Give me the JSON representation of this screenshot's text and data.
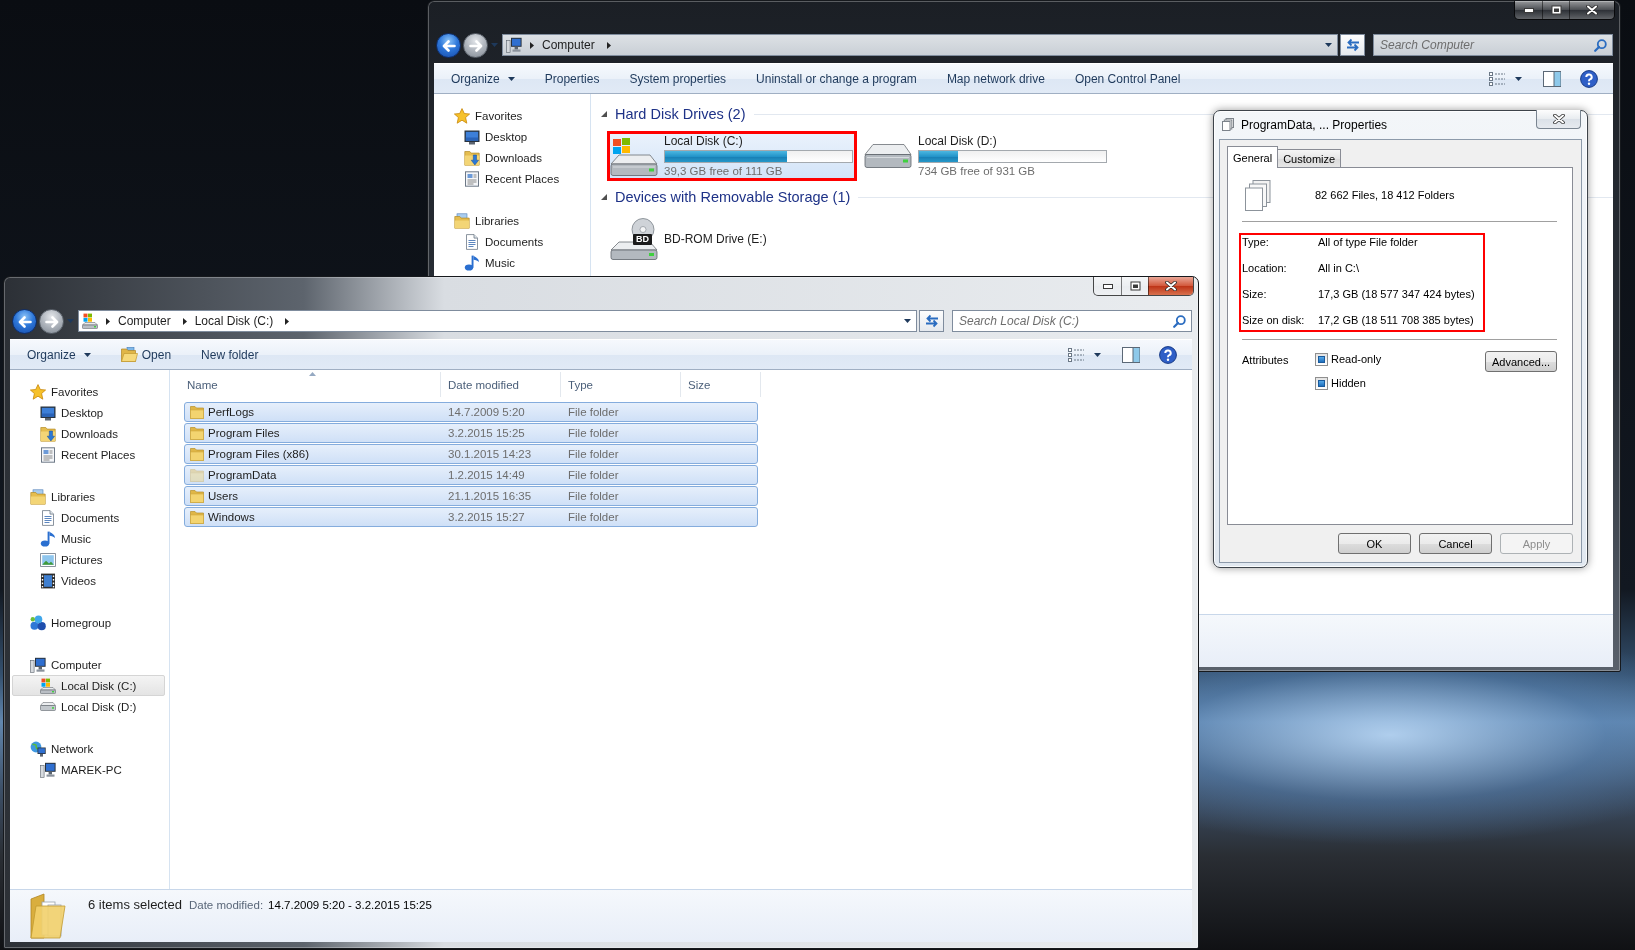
{
  "back_window": {
    "active": false,
    "nav": {
      "back_disabled": false,
      "forward_disabled": true,
      "address": [
        "Computer"
      ],
      "search": {
        "placeholder": "Search Computer"
      }
    },
    "toolbar": [
      {
        "label": "Organize",
        "kind": "menu"
      },
      {
        "label": "Properties",
        "kind": "command"
      },
      {
        "label": "System properties",
        "kind": "command"
      },
      {
        "label": "Uninstall or change a program",
        "kind": "command"
      },
      {
        "label": "Map network drive",
        "kind": "command"
      },
      {
        "label": "Open Control Panel",
        "kind": "command"
      }
    ],
    "sidebar": {
      "items": [
        {
          "label": "Favorites",
          "selected": false,
          "children": [
            {
              "label": "Desktop",
              "selected": false
            },
            {
              "label": "Downloads",
              "selected": false
            },
            {
              "label": "Recent Places",
              "selected": false
            }
          ]
        },
        {
          "label": "Libraries",
          "selected": false,
          "children": [
            {
              "label": "Documents",
              "selected": false
            },
            {
              "label": "Music",
              "selected": false
            }
          ]
        }
      ]
    },
    "groups": [
      {
        "title": "Hard Disk Drives (2)",
        "expanded": true,
        "items": [
          {
            "kind": "system",
            "name": "Local Disk (C:)",
            "level": 0.65,
            "free": "39,3 GB free of 111 GB",
            "selected": true,
            "highlighted": true
          },
          {
            "kind": "disk",
            "name": "Local Disk (D:)",
            "level": 0.21,
            "free": "734 GB free of 931 GB",
            "selected": false,
            "highlighted": false
          }
        ]
      },
      {
        "title": "Devices with Removable Storage (1)",
        "expanded": true,
        "items": [
          {
            "kind": "optical",
            "name": "BD-ROM Drive (E:)",
            "disc_label": "BD",
            "selected": false,
            "highlighted": false
          }
        ]
      }
    ]
  },
  "properties_dialog": {
    "active": false,
    "title": "ProgramData, ... Properties",
    "tabs": [
      {
        "label": "General",
        "selected": true
      },
      {
        "label": "Customize",
        "selected": false
      }
    ],
    "summary": "82 662 Files, 18 412 Folders",
    "details_highlighted": true,
    "details": [
      {
        "label": "Type:",
        "value": "All of type File folder"
      },
      {
        "label": "Location:",
        "value": "All in C:\\"
      },
      {
        "label": "Size:",
        "value": "17,3 GB (18 577 347 424 bytes)"
      },
      {
        "label": "Size on disk:",
        "value": "17,2 GB (18 511 708 385 bytes)"
      }
    ],
    "attributes": {
      "label": "Attributes",
      "options": [
        {
          "label": "Read-only",
          "checked": false,
          "indeterminate": true
        },
        {
          "label": "Hidden",
          "checked": false,
          "indeterminate": true
        }
      ],
      "advanced_button": "Advanced..."
    },
    "buttons": [
      {
        "label": "OK",
        "disabled": false
      },
      {
        "label": "Cancel",
        "disabled": false
      },
      {
        "label": "Apply",
        "disabled": true
      }
    ]
  },
  "front_window": {
    "active": true,
    "nav": {
      "back_disabled": false,
      "forward_disabled": true,
      "address": [
        "Computer",
        "Local Disk (C:)"
      ],
      "search": {
        "placeholder": "Search Local Disk (C:)"
      }
    },
    "toolbar": [
      {
        "label": "Organize",
        "kind": "menu"
      },
      {
        "label": "Open",
        "kind": "icon"
      },
      {
        "label": "New folder",
        "kind": "command"
      }
    ],
    "sidebar": {
      "items": [
        {
          "label": "Favorites",
          "selected": false,
          "children": [
            {
              "label": "Desktop",
              "selected": false
            },
            {
              "label": "Downloads",
              "selected": false
            },
            {
              "label": "Recent Places",
              "selected": false
            }
          ]
        },
        {
          "label": "Libraries",
          "selected": false,
          "children": [
            {
              "label": "Documents",
              "selected": false
            },
            {
              "label": "Music",
              "selected": false
            },
            {
              "label": "Pictures",
              "selected": false
            },
            {
              "label": "Videos",
              "selected": false
            }
          ]
        },
        {
          "label": "Homegroup",
          "selected": false
        },
        {
          "label": "Computer",
          "selected": false,
          "children": [
            {
              "label": "Local Disk (C:)",
              "selected": true
            },
            {
              "label": "Local Disk (D:)",
              "selected": false
            }
          ]
        },
        {
          "label": "Network",
          "selected": false,
          "children": [
            {
              "label": "MAREK-PC",
              "selected": false
            }
          ]
        }
      ]
    },
    "table": {
      "columns": [
        {
          "label": "Name",
          "sorted": true
        },
        {
          "label": "Date modified",
          "sorted": false
        },
        {
          "label": "Type",
          "sorted": false
        },
        {
          "label": "Size",
          "sorted": false
        }
      ],
      "rows": [
        {
          "name": "PerfLogs",
          "date_modified": "14.7.2009 5:20",
          "type": "File folder",
          "selected": true,
          "hidden": false
        },
        {
          "name": "Program Files",
          "date_modified": "3.2.2015 15:25",
          "type": "File folder",
          "selected": true,
          "hidden": false
        },
        {
          "name": "Program Files (x86)",
          "date_modified": "30.1.2015 14:23",
          "type": "File folder",
          "selected": true,
          "hidden": false
        },
        {
          "name": "ProgramData",
          "date_modified": "1.2.2015 14:49",
          "type": "File folder",
          "selected": true,
          "hidden": true
        },
        {
          "name": "Users",
          "date_modified": "21.1.2015 16:35",
          "type": "File folder",
          "selected": true,
          "hidden": false
        },
        {
          "name": "Windows",
          "date_modified": "3.2.2015 15:27",
          "type": "File folder",
          "selected": true,
          "hidden": false
        }
      ]
    },
    "status_bar": {
      "summary": "6 items selected",
      "detail_label": "Date modified:",
      "detail_value": "14.7.2009 5:20 - 3.2.2015 15:25"
    }
  }
}
